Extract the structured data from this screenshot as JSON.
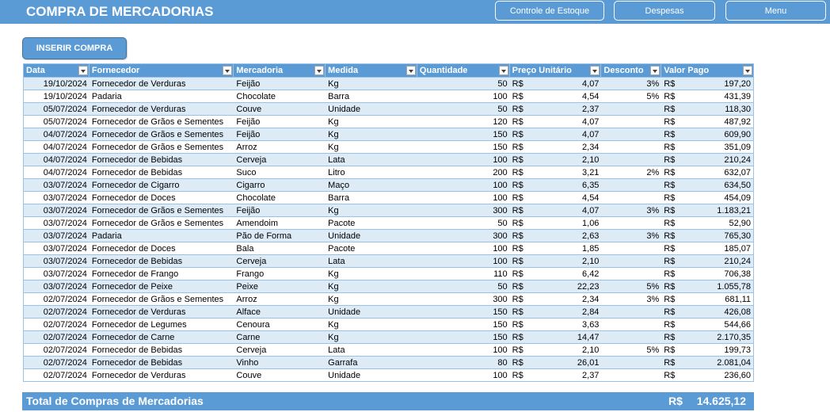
{
  "header": {
    "title": "COMPRA DE MERCADORIAS",
    "nav": [
      "Controle de Estoque",
      "Despesas",
      "Menu"
    ]
  },
  "actions": {
    "insert_label": "INSERIR COMPRA"
  },
  "table": {
    "columns": [
      "Data",
      "Fornecedor",
      "Mercadoria",
      "Medida",
      "Quantidade",
      "Preço Unitário",
      "Desconto",
      "Valor Pago"
    ],
    "currency": "R$",
    "rows": [
      [
        "19/10/2024",
        "Fornecedor de Verduras",
        "Feijão",
        "Kg",
        "50",
        "4,07",
        "3%",
        "197,20"
      ],
      [
        "19/10/2024",
        "Padaria",
        "Chocolate",
        "Barra",
        "100",
        "4,54",
        "5%",
        "431,39"
      ],
      [
        "05/07/2024",
        "Fornecedor de Verduras",
        "Couve",
        "Unidade",
        "50",
        "2,37",
        "",
        "118,30"
      ],
      [
        "05/07/2024",
        "Fornecedor de Grãos e Sementes",
        "Feijão",
        "Kg",
        "120",
        "4,07",
        "",
        "487,92"
      ],
      [
        "04/07/2024",
        "Fornecedor de Grãos e Sementes",
        "Feijão",
        "Kg",
        "150",
        "4,07",
        "",
        "609,90"
      ],
      [
        "04/07/2024",
        "Fornecedor de Grãos e Sementes",
        "Arroz",
        "Kg",
        "150",
        "2,34",
        "",
        "351,09"
      ],
      [
        "04/07/2024",
        "Fornecedor de Bebidas",
        "Cerveja",
        "Lata",
        "100",
        "2,10",
        "",
        "210,24"
      ],
      [
        "04/07/2024",
        "Fornecedor de Bebidas",
        "Suco",
        "Litro",
        "200",
        "3,21",
        "2%",
        "632,07"
      ],
      [
        "03/07/2024",
        "Fornecedor de Cigarro",
        "Cigarro",
        "Maço",
        "100",
        "6,35",
        "",
        "634,50"
      ],
      [
        "03/07/2024",
        "Fornecedor de Doces",
        "Chocolate",
        "Barra",
        "100",
        "4,54",
        "",
        "454,09"
      ],
      [
        "03/07/2024",
        "Fornecedor de Grãos e Sementes",
        "Feijão",
        "Kg",
        "300",
        "4,07",
        "3%",
        "1.183,21"
      ],
      [
        "03/07/2024",
        "Fornecedor de Grãos e Sementes",
        "Amendoim",
        "Pacote",
        "50",
        "1,06",
        "",
        "52,90"
      ],
      [
        "03/07/2024",
        "Padaria",
        "Pão de Forma",
        "Unidade",
        "300",
        "2,63",
        "3%",
        "765,30"
      ],
      [
        "03/07/2024",
        "Fornecedor de Doces",
        "Bala",
        "Pacote",
        "100",
        "1,85",
        "",
        "185,07"
      ],
      [
        "03/07/2024",
        "Fornecedor de Bebidas",
        "Cerveja",
        "Lata",
        "100",
        "2,10",
        "",
        "210,24"
      ],
      [
        "03/07/2024",
        "Fornecedor de Frango",
        "Frango",
        "Kg",
        "110",
        "6,42",
        "",
        "706,38"
      ],
      [
        "03/07/2024",
        "Fornecedor de Peixe",
        "Peixe",
        "Kg",
        "50",
        "22,23",
        "5%",
        "1.055,78"
      ],
      [
        "02/07/2024",
        "Fornecedor de Grãos e Sementes",
        "Arroz",
        "Kg",
        "300",
        "2,34",
        "3%",
        "681,11"
      ],
      [
        "02/07/2024",
        "Fornecedor de Verduras",
        "Alface",
        "Unidade",
        "150",
        "2,84",
        "",
        "426,08"
      ],
      [
        "02/07/2024",
        "Fornecedor de Legumes",
        "Cenoura",
        "Kg",
        "150",
        "3,63",
        "",
        "544,66"
      ],
      [
        "02/07/2024",
        "Fornecedor de Carne",
        "Carne",
        "Kg",
        "150",
        "14,47",
        "",
        "2.170,35"
      ],
      [
        "02/07/2024",
        "Fornecedor de Bebidas",
        "Cerveja",
        "Lata",
        "100",
        "2,10",
        "5%",
        "199,73"
      ],
      [
        "02/07/2024",
        "Fornecedor de Bebidas",
        "Vinho",
        "Garrafa",
        "80",
        "26,01",
        "",
        "2.081,04"
      ],
      [
        "02/07/2024",
        "Fornecedor de Verduras",
        "Couve",
        "Unidade",
        "100",
        "2,37",
        "",
        "236,60"
      ]
    ]
  },
  "total": {
    "label": "Total de Compras de Mercadorias",
    "currency": "R$",
    "value": "14.625,12"
  },
  "colors": {
    "accent": "#5b9bd5",
    "band": "#ddebf7",
    "border": "#9bc2e6"
  }
}
